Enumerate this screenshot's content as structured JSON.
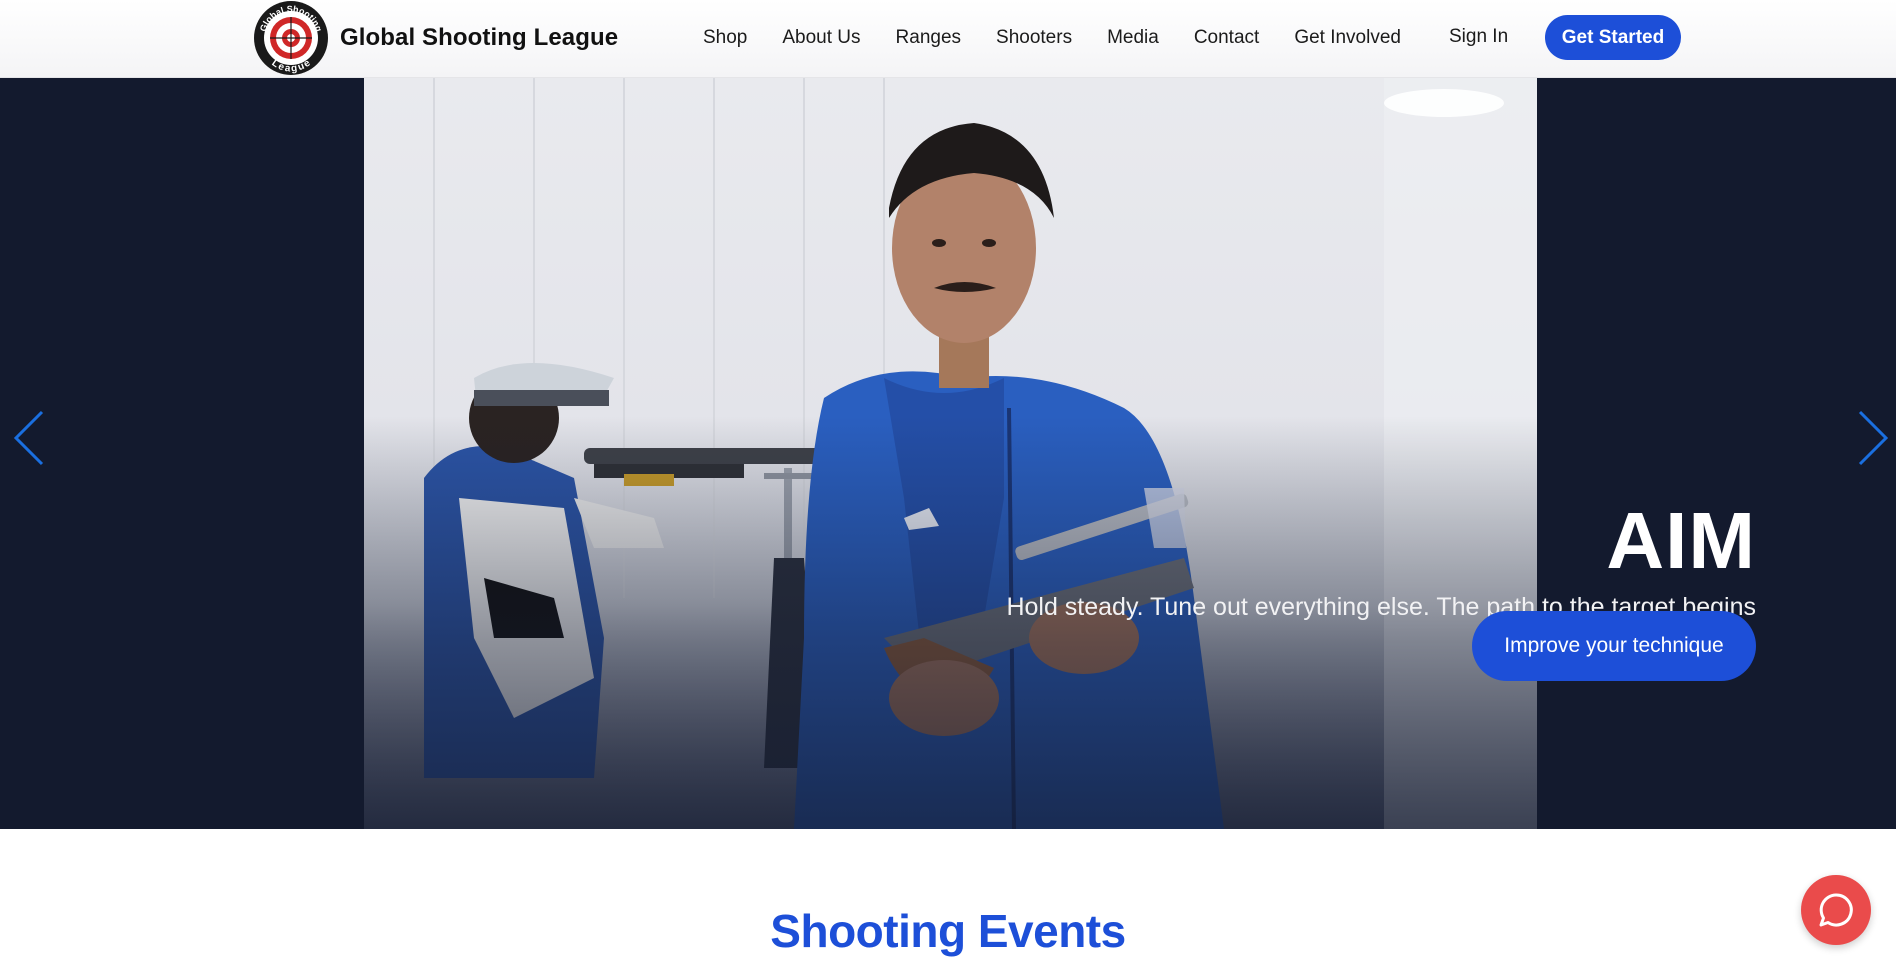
{
  "header": {
    "brand_name": "Global Shooting League",
    "logo_text_top": "Global Shooting",
    "logo_text_bottom": "League",
    "nav": [
      {
        "label": "Shop"
      },
      {
        "label": "About Us"
      },
      {
        "label": "Ranges"
      },
      {
        "label": "Shooters"
      },
      {
        "label": "Media"
      },
      {
        "label": "Contact"
      },
      {
        "label": "Get Involved"
      }
    ],
    "sign_in": "Sign In",
    "get_started": "Get Started"
  },
  "hero": {
    "title": "AIM",
    "subtitle": "Hold steady. Tune out everything else. The path to the target begins with quiet determination.",
    "cta": "Improve your technique",
    "prev_icon": "chevron-left-icon",
    "next_icon": "chevron-right-icon"
  },
  "section": {
    "title": "Shooting Events"
  },
  "chat": {
    "icon": "chat-bubble-icon"
  },
  "colors": {
    "accent": "#1d4fd8",
    "hero_bg": "#131a2e",
    "chat": "#ea4b4b",
    "arrow": "#1a6fe0"
  }
}
